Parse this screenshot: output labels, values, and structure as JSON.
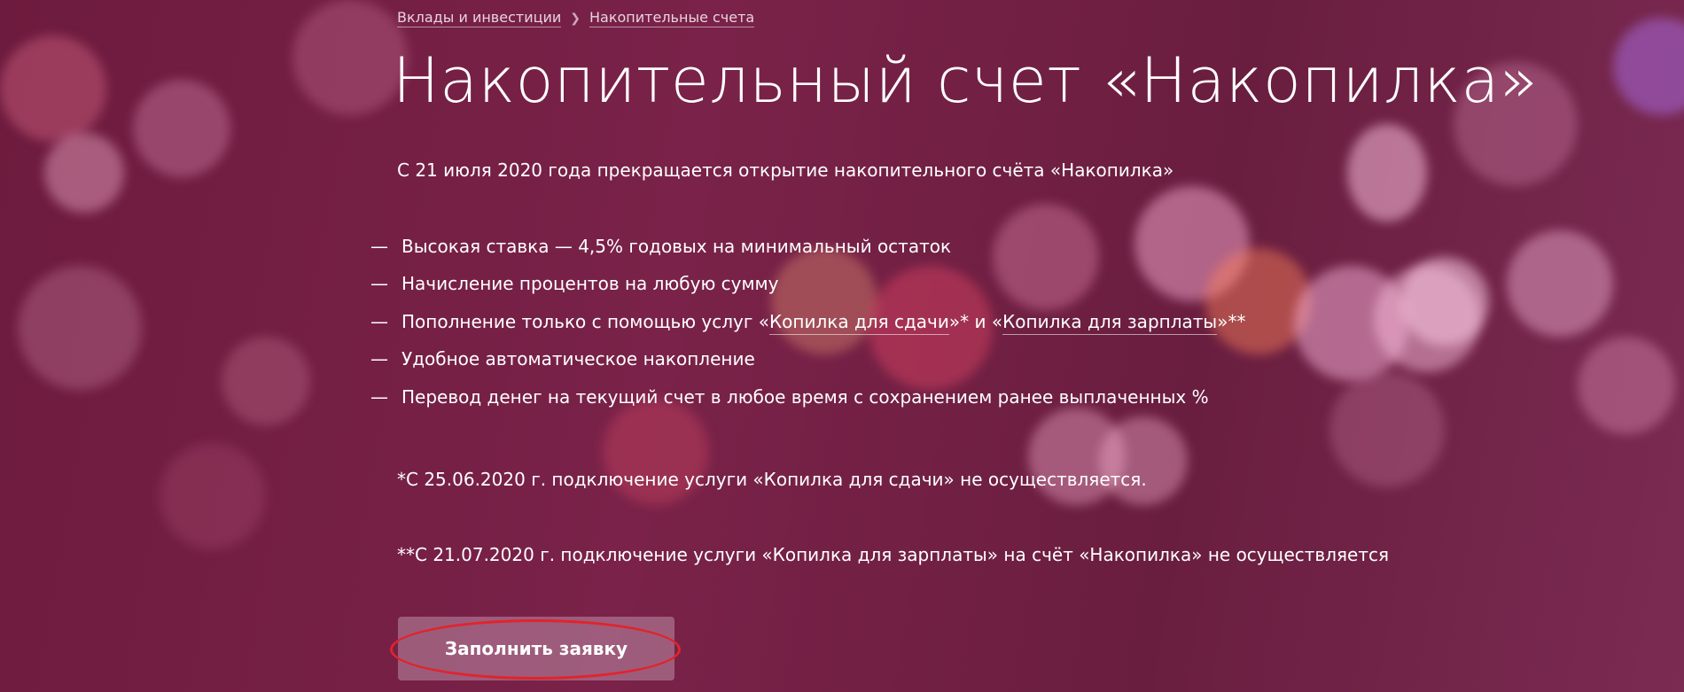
{
  "breadcrumb": {
    "items": [
      {
        "label": "Вклады и инвестиции"
      },
      {
        "label": "Накопительные счета"
      }
    ],
    "separator": "❯"
  },
  "page": {
    "title": "Накопительный счет «Накопилка»",
    "notice": "С 21 июля 2020 года прекращается открытие накопительного счёта «Накопилка»"
  },
  "features": {
    "dash": "—",
    "items": [
      {
        "text": "Высокая ставка — 4,5% годовых на минимальный остаток"
      },
      {
        "text": "Начисление процентов на любую сумму"
      },
      {
        "pre": "Пополнение только с помощью услуг «",
        "link1": "Копилка для сдачи",
        "mid": "»* и «",
        "link2": "Копилка для зарплаты",
        "post": "»**"
      },
      {
        "text": "Удобное автоматическое накопление"
      },
      {
        "text": "Перевод денег на текущий счет в любое время с сохранением ранее выплаченных %"
      }
    ]
  },
  "footnotes": {
    "first": "*С 25.06.2020 г. подключение услуги «Копилка для сдачи» не осуществляется.",
    "second": "**С 21.07.2020 г. подключение услуги «Копилка для зарплаты» на счёт «Накопилка» не осуществляется"
  },
  "actions": {
    "apply_label": "Заполнить заявку"
  },
  "colors": {
    "background": "#74204a",
    "highlight_ring": "#e0242c"
  }
}
